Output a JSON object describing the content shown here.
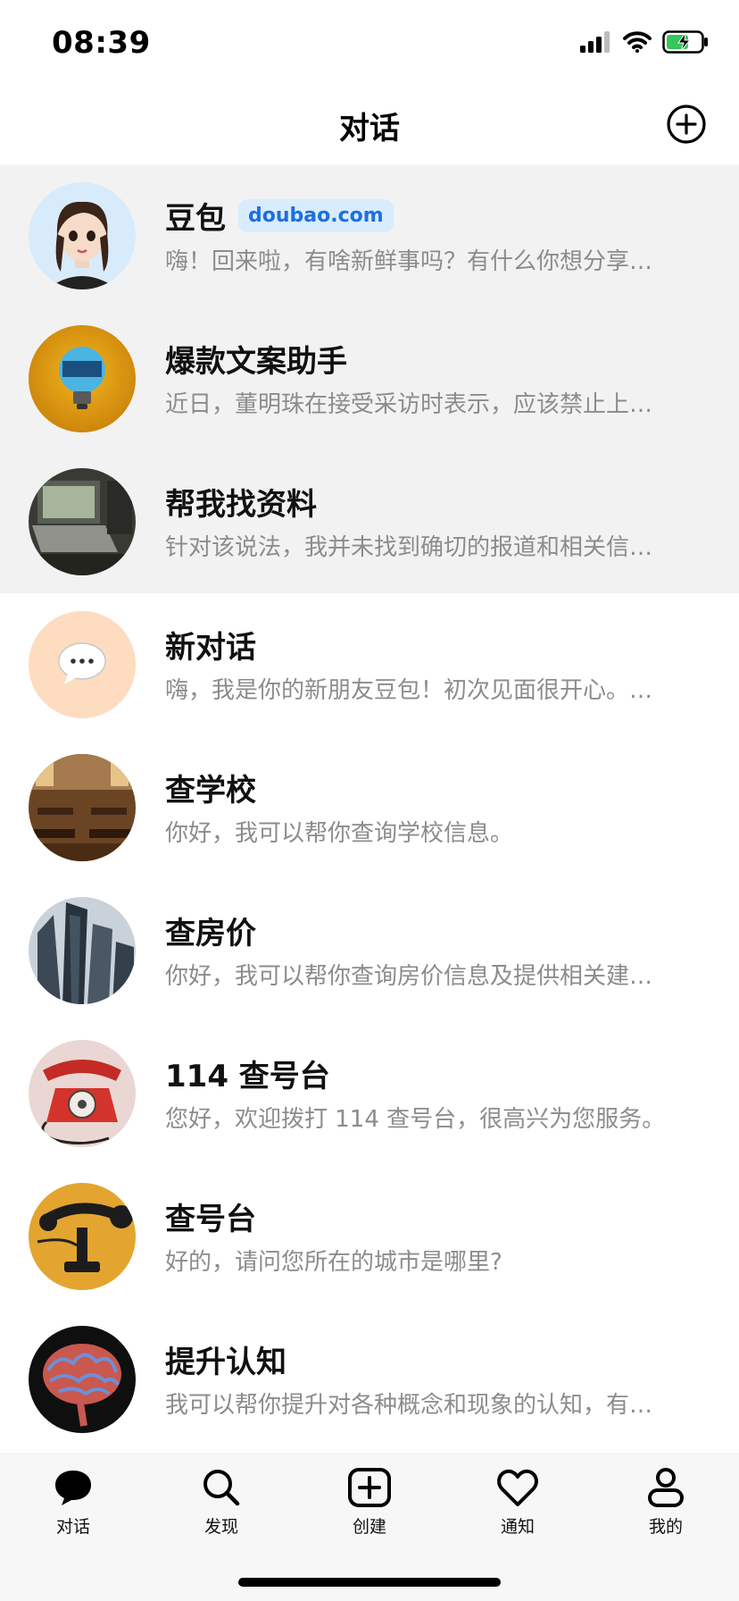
{
  "status": {
    "time": "08:39"
  },
  "header": {
    "title": "对话"
  },
  "chats": [
    {
      "title": "豆包",
      "badge": "doubao.com",
      "subtitle": "嗨！回来啦，有啥新鲜事吗？有什么你想分享…",
      "pinned": true,
      "avatar_icon": "doubao-avatar"
    },
    {
      "title": "爆款文案助手",
      "subtitle": "近日，董明珠在接受采访时表示，应该禁止上…",
      "pinned": true,
      "avatar_icon": "lightbulb-avatar"
    },
    {
      "title": "帮我找资料",
      "subtitle": "针对该说法，我并未找到确切的报道和相关信…",
      "pinned": true,
      "avatar_icon": "laptop-avatar"
    },
    {
      "title": "新对话",
      "subtitle": "嗨，我是你的新朋友豆包！初次见面很开心。…",
      "pinned": false,
      "avatar_icon": "chat-bubble-avatar"
    },
    {
      "title": " 查学校",
      "subtitle": "你好，我可以帮你查询学校信息。",
      "pinned": false,
      "avatar_icon": "classroom-avatar"
    },
    {
      "title": "查房价",
      "subtitle": "你好，我可以帮你查询房价信息及提供相关建…",
      "pinned": false,
      "avatar_icon": "buildings-avatar"
    },
    {
      "title": "114 查号台",
      "subtitle": "您好，欢迎拨打 114 查号台，很高兴为您服务。",
      "pinned": false,
      "avatar_icon": "red-telephone-avatar"
    },
    {
      "title": "查号台",
      "subtitle": "好的，请问您所在的城市是哪里?",
      "pinned": false,
      "avatar_icon": "old-telephone-avatar"
    },
    {
      "title": "提升认知",
      "subtitle": "我可以帮你提升对各种概念和现象的认知，有…",
      "pinned": false,
      "avatar_icon": "brain-avatar"
    }
  ],
  "tabs": [
    {
      "label": "对话",
      "icon": "chat-icon",
      "active": true
    },
    {
      "label": "发现",
      "icon": "search-icon",
      "active": false
    },
    {
      "label": "创建",
      "icon": "create-icon",
      "active": false
    },
    {
      "label": "通知",
      "icon": "heart-icon",
      "active": false
    },
    {
      "label": "我的",
      "icon": "profile-icon",
      "active": false
    }
  ],
  "colors": {
    "pinned_bg": "#f2f2f2",
    "badge_bg": "#d9ecfd",
    "badge_text": "#1d6fe0",
    "subtitle": "#8c8c8c"
  }
}
